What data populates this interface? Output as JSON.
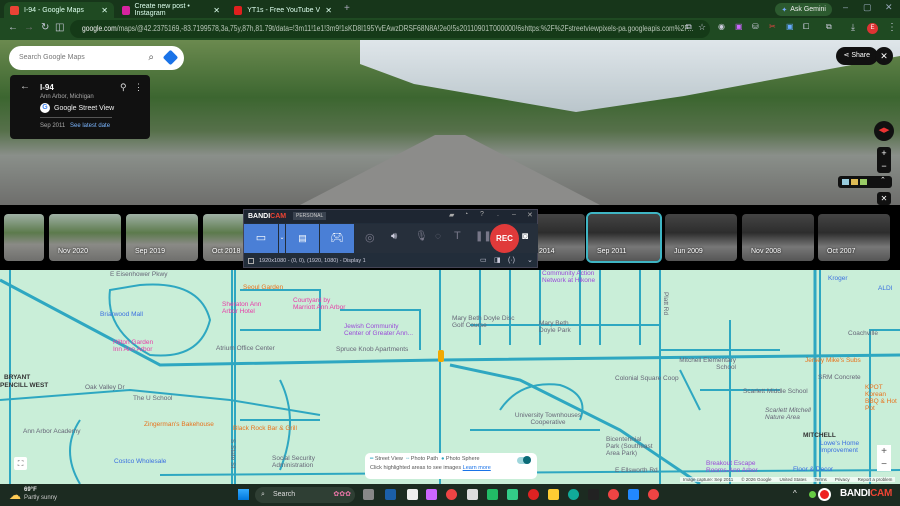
{
  "browser": {
    "tabs": [
      {
        "label": "I-94 - Google Maps",
        "active": true,
        "favicon_color": "#ea4335"
      },
      {
        "label": "Create new post • Instagram",
        "active": false,
        "favicon_color": "#d6249f"
      },
      {
        "label": "YT1s - Free YouTube Video Do...",
        "active": false,
        "favicon_color": "#e0201e"
      }
    ],
    "new_tab": "+",
    "ask_gemini": "Ask Gemini",
    "url_host": "google.com",
    "url_path": "/maps/@42.2375169,-83.7199578,3a,75y,87h,81.79t/data=!3m11!1e1!3m9!1sKD8I195YvEAwzDRSF68N8A!2e0!5s20110901T000000!6shttps:%2F%2Fstreetviewpixels-pa.googleapis.com%2F...",
    "profile_initial": "E"
  },
  "maps": {
    "search_placeholder": "Search Google Maps",
    "place_title": "I-94",
    "place_subtitle": "Ann Arbor, Michigan",
    "source": "Google Street View",
    "capture_date": "Sep 2011",
    "see_latest": "See latest date",
    "share": "Share",
    "timeline": [
      "Nov 2020",
      "Sep 2019",
      "Oct 2018",
      "2014",
      "Sep 2011",
      "Jun 2009",
      "Nov 2008",
      "Oct 2007"
    ],
    "selected_date": "Sep 2011",
    "legend": {
      "street_view": "Street View",
      "photo_path": "Photo Path",
      "photo_sphere": "Photo Sphere",
      "hint": "Click highlighted areas to see images",
      "learn_more": "Learn more"
    },
    "attribution": [
      "Image capture: Sep 2011",
      "© 2026 Google",
      "United States",
      "Terms",
      "Privacy",
      "Report a problem"
    ],
    "labels": [
      {
        "t": "E Eisenhower Pkwy",
        "c": "g"
      },
      {
        "t": "Seoul Garden",
        "c": "o"
      },
      {
        "t": "Sheraton Ann Arbor Hotel",
        "c": "p"
      },
      {
        "t": "Courtyard by Marriott Ann Arbor",
        "c": "p"
      },
      {
        "t": "Briarwood Mall",
        "c": "b"
      },
      {
        "t": "Jewish Community Center of Greater Ann...",
        "c": "v"
      },
      {
        "t": "Hilton Garden Inn Ann Arbor",
        "c": "p"
      },
      {
        "t": "Atrium Office Center",
        "c": "g"
      },
      {
        "t": "Spruce Knob Apartments",
        "c": "g"
      },
      {
        "t": "BRYANT",
        "c": "k"
      },
      {
        "t": "PENCILL WEST",
        "c": "k"
      },
      {
        "t": "The U School",
        "c": "g"
      },
      {
        "t": "Zingerman's Bakehouse",
        "c": "o"
      },
      {
        "t": "Black Rock Bar & Grill",
        "c": "o"
      },
      {
        "t": "Ann Arbor Academy",
        "c": "g"
      },
      {
        "t": "Costco Wholesale",
        "c": "b"
      },
      {
        "t": "Social Security Administration",
        "c": "g"
      },
      {
        "t": "Community Action Network at Hikone",
        "c": "v"
      },
      {
        "t": "Mary Beth Doyle Disc Golf Course",
        "c": "g"
      },
      {
        "t": "Mary Beth Doyle Park",
        "c": "g"
      },
      {
        "t": "Kroger",
        "c": "b"
      },
      {
        "t": "ALDI",
        "c": "b"
      },
      {
        "t": "Coachville",
        "c": "g"
      },
      {
        "t": "Mitchell Elementary School",
        "c": "g"
      },
      {
        "t": "Jersey Mike's Subs",
        "c": "o"
      },
      {
        "t": "Colonial Square Coop",
        "c": "g"
      },
      {
        "t": "SRM Concrete",
        "c": "g"
      },
      {
        "t": "Scarlett Middle School",
        "c": "g"
      },
      {
        "t": "KPOT Korean BBQ & Hot Pot",
        "c": "o"
      },
      {
        "t": "Scarlett Mitchell Nature Area",
        "c": "g"
      },
      {
        "t": "University Townhouses Cooperative",
        "c": "g"
      },
      {
        "t": "MITCHELL",
        "c": "k"
      },
      {
        "t": "Bicentennial Park (Southeast Area Park)",
        "c": "g"
      },
      {
        "t": "Lowe's Home Improvement",
        "c": "b"
      },
      {
        "t": "Breakout Escape Rooms-Ann Arbor",
        "c": "v"
      },
      {
        "t": "Floor & Decor",
        "c": "b"
      },
      {
        "t": "E Ellsworth Rd",
        "c": "g"
      },
      {
        "t": "Platt Rd",
        "c": "g"
      },
      {
        "t": "Oak Valley Dr",
        "c": "g"
      },
      {
        "t": "S State St",
        "c": "g"
      }
    ]
  },
  "bandicam": {
    "brand_a": "BANDI",
    "brand_b": "CAM",
    "edition": "PERSONAL",
    "rec": "REC",
    "resolution": "1920x1080 - (0, 0), (1920, 1080) - Display 1"
  },
  "taskbar": {
    "temp": "69°F",
    "weather": "Partly sunny",
    "search": "Search",
    "tray_brand_a": "BANDI",
    "tray_brand_b": "CAM"
  }
}
